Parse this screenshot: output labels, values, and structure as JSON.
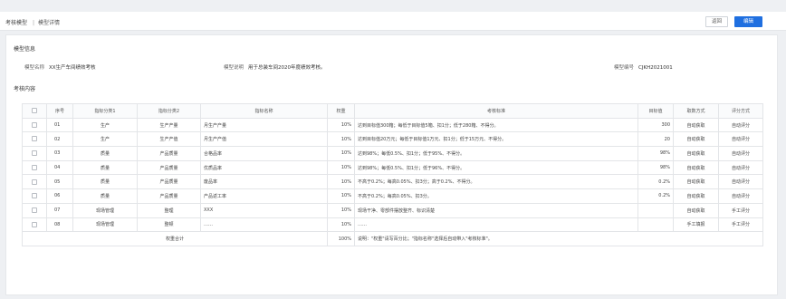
{
  "breadcrumb": {
    "first": "考核模型",
    "separator": "|",
    "current": "模型详情"
  },
  "actions": {
    "back": "返回",
    "edit": "编辑"
  },
  "model_info": {
    "section_title": "模型信息",
    "name_label": "模型名称",
    "name_value": "XX生产车间绩效考核",
    "desc_label": "模型说明",
    "desc_value": "用于总装车间2020年度绩效考核。",
    "code_label": "模型编号",
    "code_value": "CJKH2021001"
  },
  "content_title": "考核内容",
  "table": {
    "headers": [
      "序号",
      "指标分类1",
      "指标分类2",
      "指标名称",
      "权重",
      "考核标准",
      "目标值",
      "取数方式",
      "评分方式"
    ],
    "rows": [
      [
        "01",
        "生产",
        "生产产量",
        "月生产产量",
        "10%",
        "达到目标值300箱；每低于目标值5箱、扣1分；低于280箱、不得分。",
        "300",
        "自动获取",
        "自动评分"
      ],
      [
        "02",
        "生产",
        "生产产值",
        "月生产产值",
        "10%",
        "达到目标值20万元；每低于目标值1万元、扣1分；低于15万元、不得分。",
        "20",
        "自动获取",
        "自动评分"
      ],
      [
        "03",
        "质量",
        "产品质量",
        "合格品率",
        "10%",
        "达到98%；每低0.5%、扣1分；低于95%、不得分。",
        "98%",
        "自动获取",
        "自动评分"
      ],
      [
        "04",
        "质量",
        "产品质量",
        "优质品率",
        "10%",
        "达到98%；每低0.5%、扣1分；低于96%、不得分。",
        "98%",
        "自动获取",
        "自动评分"
      ],
      [
        "05",
        "质量",
        "产品质量",
        "废品率",
        "10%",
        "不高于0.2%；每高0.05%、扣3分；高于0.2%、不得分。",
        "0.2%",
        "自动获取",
        "自动评分"
      ],
      [
        "06",
        "质量",
        "产品质量",
        "产品返工率",
        "10%",
        "不高于0.2%；每高0.05%、扣3分。",
        "0.2%",
        "自动获取",
        "自动评分"
      ],
      [
        "07",
        "现场管理",
        "整理",
        "XXX",
        "10%",
        "现场干净、零部件摆放整齐、标识清楚",
        "",
        "自动获取",
        "手工评分"
      ],
      [
        "08",
        "现场管理",
        "整顿",
        "……",
        "10%",
        "……",
        "",
        "手工填报",
        "手工评分"
      ]
    ],
    "summary": {
      "label": "权重合计",
      "total": "100%",
      "note": "说明：\"权重\"请写百分比；\"指标名称\"选择后自动带入\"考核标准\"。"
    }
  }
}
